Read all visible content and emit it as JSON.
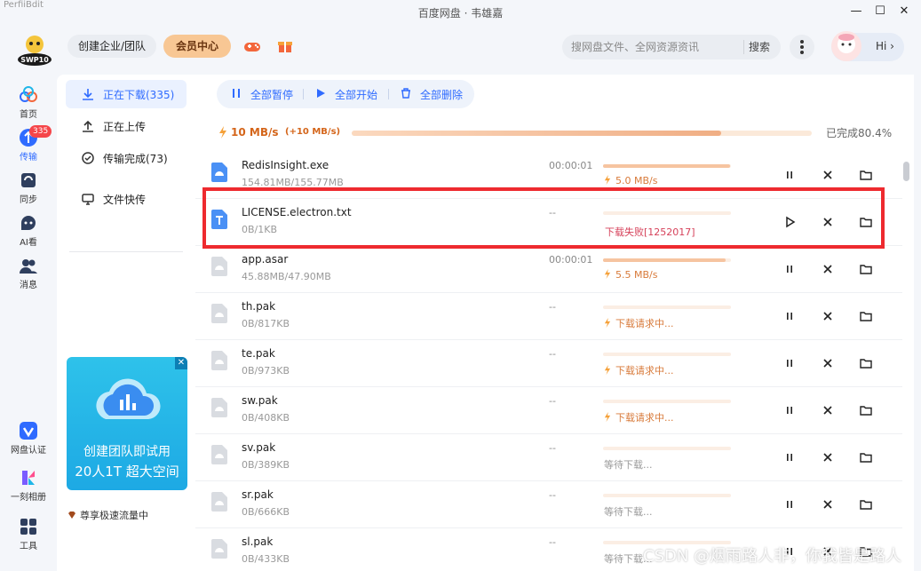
{
  "window": {
    "app_name": "PerfiiBdit",
    "title": "百度网盘 · 韦雄嘉",
    "minimize": "—",
    "maximize": "☐",
    "close": "✕"
  },
  "header": {
    "logo_text": "SWP10",
    "team_button": "创建企业/团队",
    "vip_button": "会员中心",
    "search_placeholder": "搜网盘文件、全网资源资讯",
    "search_button": "搜索",
    "hi_label": "Hi ›"
  },
  "leftnav": {
    "items": [
      {
        "label": "首页"
      },
      {
        "label": "传输",
        "badge": "335"
      },
      {
        "label": "同步"
      },
      {
        "label": "AI看"
      },
      {
        "label": "消息"
      },
      {
        "label": "网盘认证"
      },
      {
        "label": "一刻相册"
      },
      {
        "label": "工具"
      }
    ]
  },
  "subpanel": {
    "items": [
      {
        "label": "正在下载(335)"
      },
      {
        "label": "正在上传"
      },
      {
        "label": "传输完成(73)"
      },
      {
        "label": "文件快传"
      }
    ],
    "promo": {
      "line1": "创建团队即试用",
      "line2": "20人1T 超大空间",
      "close": "✕"
    },
    "vip_speed": "尊享极速流量中"
  },
  "toolbar": {
    "pause_all": "全部暂停",
    "start_all": "全部开始",
    "delete_all": "全部删除"
  },
  "summary": {
    "speed": "10 MB/s",
    "bonus": "(+10 MB/s)",
    "progress": 0.804,
    "done_label": "已完成80.4%"
  },
  "files": [
    {
      "name": "RedisInsight.exe",
      "size": "154.81MB/155.77MB",
      "time": "00:00:01",
      "progress": 0.99,
      "status": "5.0 MB/s",
      "state": "speed",
      "icon": "exe-blue"
    },
    {
      "name": "LICENSE.electron.txt",
      "size": "0B/1KB",
      "time": "--",
      "progress": 0,
      "status": "下载失败[1252017]",
      "state": "error",
      "icon": "txt-blue"
    },
    {
      "name": "app.asar",
      "size": "45.88MB/47.90MB",
      "time": "00:00:01",
      "progress": 0.96,
      "status": "5.5 MB/s",
      "state": "speed",
      "icon": "generic"
    },
    {
      "name": "th.pak",
      "size": "0B/817KB",
      "time": "--",
      "progress": 0,
      "status": "下载请求中...",
      "state": "requesting",
      "icon": "generic"
    },
    {
      "name": "te.pak",
      "size": "0B/973KB",
      "time": "--",
      "progress": 0,
      "status": "下载请求中...",
      "state": "requesting",
      "icon": "generic"
    },
    {
      "name": "sw.pak",
      "size": "0B/408KB",
      "time": "--",
      "progress": 0,
      "status": "下载请求中...",
      "state": "requesting",
      "icon": "generic"
    },
    {
      "name": "sv.pak",
      "size": "0B/389KB",
      "time": "--",
      "progress": 0,
      "status": "等待下载...",
      "state": "waiting",
      "icon": "generic"
    },
    {
      "name": "sr.pak",
      "size": "0B/666KB",
      "time": "--",
      "progress": 0,
      "status": "等待下载...",
      "state": "waiting",
      "icon": "generic"
    },
    {
      "name": "sl.pak",
      "size": "0B/433KB",
      "time": "--",
      "progress": 0,
      "status": "等待下载...",
      "state": "waiting",
      "icon": "generic"
    }
  ],
  "watermark": "CSDN @烟雨路人非，你我皆是路人",
  "colors": {
    "accent": "#2f6bff",
    "orange": "#d87a3a",
    "error": "#d6415a",
    "highlight": "#ee2a2f"
  }
}
